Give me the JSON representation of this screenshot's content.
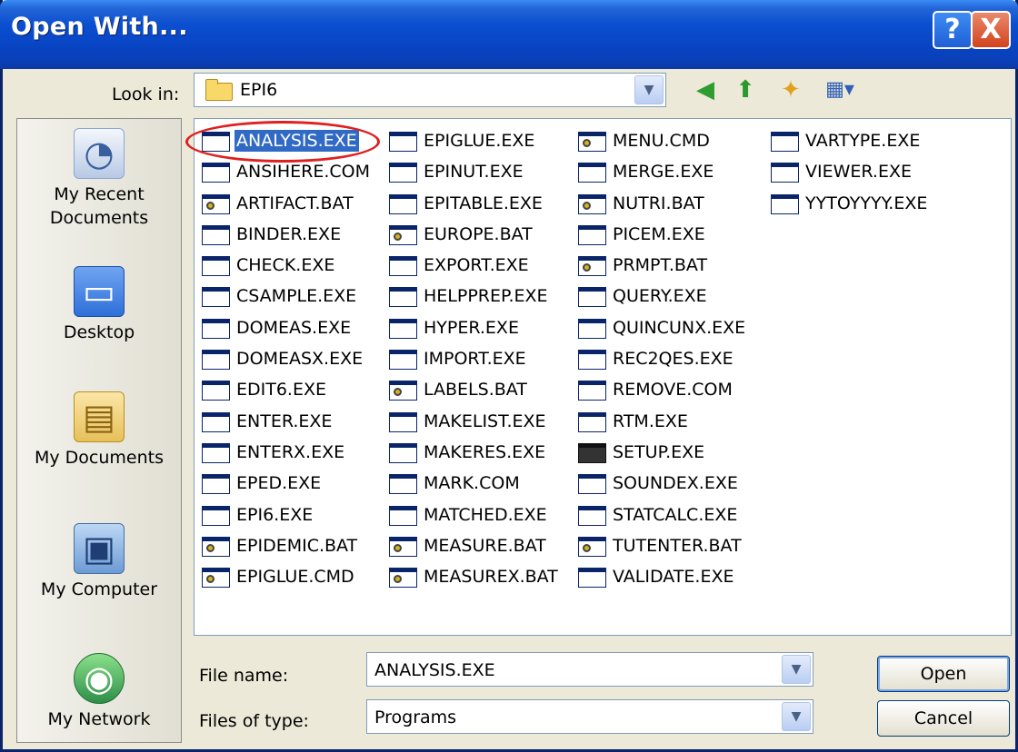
{
  "window": {
    "title": "Open With...",
    "help_glyph": "?",
    "close_glyph": "X"
  },
  "toolbar": {
    "look_in_label": "Look in:",
    "look_in_value": "EPI6",
    "icons": [
      "back-icon",
      "up-folder-icon",
      "new-folder-icon",
      "views-menu-icon"
    ]
  },
  "places": [
    {
      "label": "My Recent\nDocuments",
      "icon": "recent-documents-icon"
    },
    {
      "label": "Desktop",
      "icon": "desktop-icon"
    },
    {
      "label": "My Documents",
      "icon": "my-documents-icon"
    },
    {
      "label": "My Computer",
      "icon": "my-computer-icon"
    },
    {
      "label": "My Network",
      "icon": "my-network-icon"
    }
  ],
  "files": {
    "columns": [
      [
        {
          "name": "ANALYSIS.EXE",
          "type": "exe",
          "selected": true
        },
        {
          "name": "ANSIHERE.COM",
          "type": "exe"
        },
        {
          "name": "ARTIFACT.BAT",
          "type": "bat"
        },
        {
          "name": "BINDER.EXE",
          "type": "exe"
        },
        {
          "name": "CHECK.EXE",
          "type": "exe"
        },
        {
          "name": "CSAMPLE.EXE",
          "type": "exe"
        },
        {
          "name": "DOMEAS.EXE",
          "type": "exe"
        },
        {
          "name": "DOMEASX.EXE",
          "type": "exe"
        },
        {
          "name": "EDIT6.EXE",
          "type": "exe"
        },
        {
          "name": "ENTER.EXE",
          "type": "exe"
        },
        {
          "name": "ENTERX.EXE",
          "type": "exe"
        },
        {
          "name": "EPED.EXE",
          "type": "exe"
        },
        {
          "name": "EPI6.EXE",
          "type": "exe"
        },
        {
          "name": "EPIDEMIC.BAT",
          "type": "bat"
        },
        {
          "name": "EPIGLUE.CMD",
          "type": "bat"
        }
      ],
      [
        {
          "name": "EPIGLUE.EXE",
          "type": "exe"
        },
        {
          "name": "EPINUT.EXE",
          "type": "exe"
        },
        {
          "name": "EPITABLE.EXE",
          "type": "exe"
        },
        {
          "name": "EUROPE.BAT",
          "type": "bat"
        },
        {
          "name": "EXPORT.EXE",
          "type": "exe"
        },
        {
          "name": "HELPPREP.EXE",
          "type": "exe"
        },
        {
          "name": "HYPER.EXE",
          "type": "exe"
        },
        {
          "name": "IMPORT.EXE",
          "type": "exe"
        },
        {
          "name": "LABELS.BAT",
          "type": "bat"
        },
        {
          "name": "MAKELIST.EXE",
          "type": "exe"
        },
        {
          "name": "MAKERES.EXE",
          "type": "exe"
        },
        {
          "name": "MARK.COM",
          "type": "exe"
        },
        {
          "name": "MATCHED.EXE",
          "type": "exe"
        },
        {
          "name": "MEASURE.BAT",
          "type": "bat"
        },
        {
          "name": "MEASUREX.BAT",
          "type": "bat"
        }
      ],
      [
        {
          "name": "MENU.CMD",
          "type": "bat"
        },
        {
          "name": "MERGE.EXE",
          "type": "exe"
        },
        {
          "name": "NUTRI.BAT",
          "type": "bat"
        },
        {
          "name": "PICEM.EXE",
          "type": "exe"
        },
        {
          "name": "PRMPT.BAT",
          "type": "bat"
        },
        {
          "name": "QUERY.EXE",
          "type": "exe"
        },
        {
          "name": "QUINCUNX.EXE",
          "type": "exe"
        },
        {
          "name": "REC2QES.EXE",
          "type": "exe"
        },
        {
          "name": "REMOVE.COM",
          "type": "exe"
        },
        {
          "name": "RTM.EXE",
          "type": "exe"
        },
        {
          "name": "SETUP.EXE",
          "type": "setup"
        },
        {
          "name": "SOUNDEX.EXE",
          "type": "exe"
        },
        {
          "name": "STATCALC.EXE",
          "type": "exe"
        },
        {
          "name": "TUTENTER.BAT",
          "type": "bat"
        },
        {
          "name": "VALIDATE.EXE",
          "type": "exe"
        }
      ],
      [
        {
          "name": "VARTYPE.EXE",
          "type": "exe"
        },
        {
          "name": "VIEWER.EXE",
          "type": "exe"
        },
        {
          "name": "YYTOYYYY.EXE",
          "type": "exe"
        }
      ]
    ]
  },
  "form": {
    "file_name_label": "File name:",
    "file_name_value": "ANALYSIS.EXE",
    "file_type_label": "Files of type:",
    "file_type_value": "Programs"
  },
  "buttons": {
    "open_label": "Open",
    "cancel_label": "Cancel"
  },
  "colors": {
    "selection": "#316AC5",
    "annotation_circle": "#E01F1F"
  }
}
